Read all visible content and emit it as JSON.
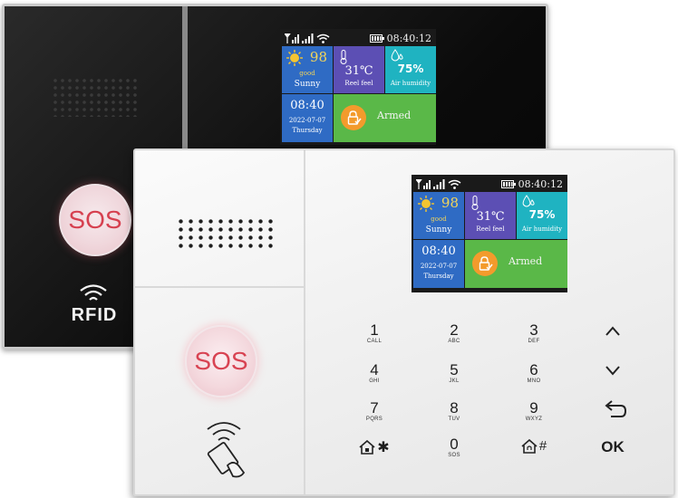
{
  "colors": {
    "weather_tile": "#2f6bc4",
    "temp_tile": "#5c4fb4",
    "humidity_tile": "#1fb3c1",
    "date_tile": "#2f6bc4",
    "armed_tile": "#5ab848",
    "sos_text": "#d84352"
  },
  "back_panel": {
    "sos_label": "SOS",
    "rfid_label": "RFID",
    "screen": {
      "clock": "08:40:12",
      "weather": {
        "score": "98",
        "quality": "good",
        "condition": "Sunny",
        "icon": "sun-icon"
      },
      "temperature": {
        "value": "31℃",
        "label": "Reel feel",
        "icon": "thermometer-icon"
      },
      "humidity": {
        "value": "75%",
        "label": "Air humidity",
        "icon": "droplet-icon"
      },
      "datetime": {
        "time": "08:40",
        "date": "2022-07-07",
        "day": "Thursday"
      },
      "alarm": {
        "status": "Armed",
        "icon": "lock-check-icon"
      }
    }
  },
  "front_panel": {
    "sos_label": "SOS",
    "screen": {
      "clock": "08:40:12",
      "weather": {
        "score": "98",
        "quality": "good",
        "condition": "Sunny",
        "icon": "sun-icon"
      },
      "temperature": {
        "value": "31℃",
        "label": "Reel feel",
        "icon": "thermometer-icon"
      },
      "humidity": {
        "value": "75%",
        "label": "Air humidity",
        "icon": "droplet-icon"
      },
      "datetime": {
        "time": "08:40",
        "date": "2022-07-07",
        "day": "Thursday"
      },
      "alarm": {
        "status": "Armed",
        "icon": "lock-check-icon"
      }
    },
    "keypad": {
      "k1": {
        "digit": "1",
        "letters": "CALL"
      },
      "k2": {
        "digit": "2",
        "letters": "ABC"
      },
      "k3": {
        "digit": "3",
        "letters": "DEF"
      },
      "k4": {
        "digit": "4",
        "letters": "GHI"
      },
      "k5": {
        "digit": "5",
        "letters": "JKL"
      },
      "k6": {
        "digit": "6",
        "letters": "MNO"
      },
      "k7": {
        "digit": "7",
        "letters": "PQRS"
      },
      "k8": {
        "digit": "8",
        "letters": "TUV"
      },
      "k9": {
        "digit": "9",
        "letters": "WXYZ"
      },
      "k0": {
        "digit": "0",
        "letters": "SOS"
      },
      "star": "✱",
      "hash": "#",
      "ok": "OK"
    }
  }
}
